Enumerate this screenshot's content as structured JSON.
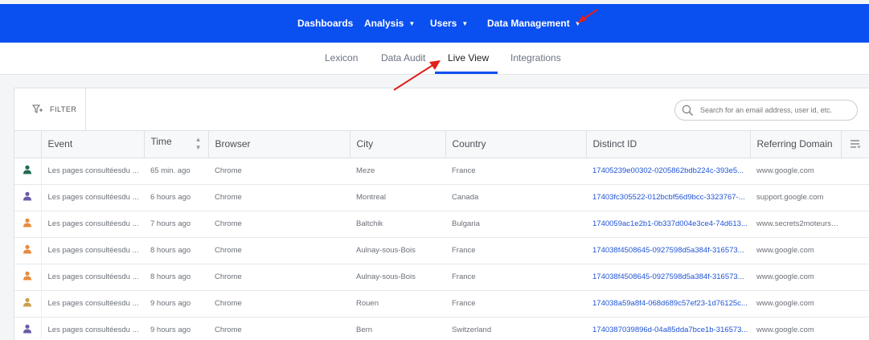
{
  "topnav": {
    "items": [
      {
        "label": "Dashboards",
        "caret": false
      },
      {
        "label": "Analysis",
        "caret": true
      },
      {
        "label": "Users",
        "caret": true
      },
      {
        "label": "Data Management",
        "caret": true
      }
    ]
  },
  "subnav": {
    "tabs": [
      "Lexicon",
      "Data Audit",
      "Live View",
      "Integrations"
    ],
    "active": "Live View"
  },
  "toolbar": {
    "filter_label": "FILTER",
    "search_placeholder": "Search for an email address, user id, etc."
  },
  "table": {
    "columns": [
      "Event",
      "Time",
      "Browser",
      "City",
      "Country",
      "Distinct ID",
      "Referring Domain"
    ],
    "rows": [
      {
        "avatar_color": "#1f6b4f",
        "event": "Les pages consultéesdu ...",
        "time": "65 min. ago",
        "browser": "Chrome",
        "city": "Meze",
        "country": "France",
        "distinct_id": "17405239e00302-0205862bdb224c-393e5...",
        "domain": "www.google.com"
      },
      {
        "avatar_color": "#6b5aa8",
        "event": "Les pages consultéesdu ...",
        "time": "6 hours ago",
        "browser": "Chrome",
        "city": "Montreal",
        "country": "Canada",
        "distinct_id": "17403fc305522-012bcbf56d9bcc-3323767-...",
        "domain": "support.google.com"
      },
      {
        "avatar_color": "#e98a3c",
        "event": "Les pages consultéesdu ...",
        "time": "7 hours ago",
        "browser": "Chrome",
        "city": "Baltchik",
        "country": "Bulgaria",
        "distinct_id": "1740059ac1e2b1-0b337d004e3ce4-74d613...",
        "domain": "www.secrets2moteurs.com"
      },
      {
        "avatar_color": "#e98a3c",
        "event": "Les pages consultéesdu ...",
        "time": "8 hours ago",
        "browser": "Chrome",
        "city": "Aulnay-sous-Bois",
        "country": "France",
        "distinct_id": "174038f4508645-0927598d5a384f-316573...",
        "domain": "www.google.com"
      },
      {
        "avatar_color": "#e98a3c",
        "event": "Les pages consultéesdu ...",
        "time": "8 hours ago",
        "browser": "Chrome",
        "city": "Aulnay-sous-Bois",
        "country": "France",
        "distinct_id": "174038f4508645-0927598d5a384f-316573...",
        "domain": "www.google.com"
      },
      {
        "avatar_color": "#c9a04a",
        "event": "Les pages consultéesdu ...",
        "time": "9 hours ago",
        "browser": "Chrome",
        "city": "Rouen",
        "country": "France",
        "distinct_id": "174038a59a8f4-068d689c57ef23-1d76125c...",
        "domain": "www.google.com"
      },
      {
        "avatar_color": "#6b5aa8",
        "event": "Les pages consultéesdu ...",
        "time": "9 hours ago",
        "browser": "Chrome",
        "city": "Bern",
        "country": "Switzerland",
        "distinct_id": "1740387039896d-04a85dda7bce1b-316573...",
        "domain": "www.google.com"
      }
    ]
  },
  "colors": {
    "brand": "#0a4ff0",
    "annotation_arrow": "#e0201b",
    "link": "#1f54d6"
  }
}
